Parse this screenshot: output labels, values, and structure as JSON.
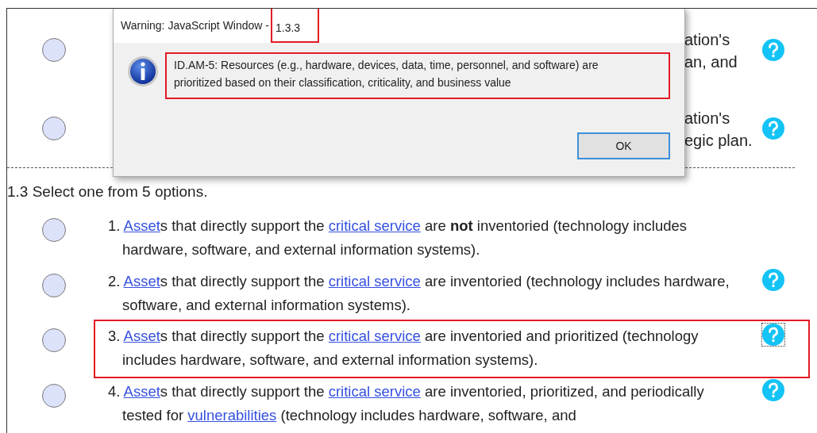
{
  "background_rows": [
    {
      "selected": false,
      "visible_lines": [
        "ation's",
        "an, and"
      ],
      "help": true
    },
    {
      "selected": false,
      "visible_lines": [
        "ation's",
        "egic plan."
      ],
      "help": true
    }
  ],
  "question": {
    "heading": "1.3 Select one from 5 options.",
    "options": [
      {
        "number": "1.",
        "selected": false,
        "help": false,
        "focused": false,
        "highlighted": false,
        "segments": [
          {
            "kind": "link",
            "text": "Asset"
          },
          {
            "kind": "text",
            "text": "s that directly support the "
          },
          {
            "kind": "link",
            "text": "critical service"
          },
          {
            "kind": "text",
            "text": " are "
          },
          {
            "kind": "bold",
            "text": "not"
          },
          {
            "kind": "text",
            "text": " inventoried (technology includes hardware, software, and external information systems)."
          }
        ]
      },
      {
        "number": "2.",
        "selected": false,
        "help": true,
        "focused": false,
        "highlighted": false,
        "segments": [
          {
            "kind": "link",
            "text": "Asset"
          },
          {
            "kind": "text",
            "text": "s that directly support the "
          },
          {
            "kind": "link",
            "text": "critical service"
          },
          {
            "kind": "text",
            "text": " are inventoried (technology includes hardware, software, and external information systems)."
          }
        ]
      },
      {
        "number": "3.",
        "selected": false,
        "help": true,
        "focused": true,
        "highlighted": true,
        "segments": [
          {
            "kind": "link",
            "text": "Asset"
          },
          {
            "kind": "text",
            "text": "s that directly support the "
          },
          {
            "kind": "link",
            "text": "critical service"
          },
          {
            "kind": "text",
            "text": " are inventoried and prioritized (technology includes hardware, software, and external information systems)."
          }
        ]
      },
      {
        "number": "4.",
        "selected": false,
        "help": true,
        "focused": false,
        "highlighted": false,
        "segments": [
          {
            "kind": "link",
            "text": "Asset"
          },
          {
            "kind": "text",
            "text": "s that directly support the "
          },
          {
            "kind": "link",
            "text": "critical service"
          },
          {
            "kind": "text",
            "text": " are inventoried, prioritized, and periodically tested for "
          },
          {
            "kind": "link",
            "text": "vulnerabilities"
          },
          {
            "kind": "text",
            "text": " (technology includes hardware, software, and"
          }
        ]
      }
    ]
  },
  "dialog": {
    "title": "Warning: JavaScript Window -",
    "version": "1.3.3",
    "version_highlighted": true,
    "message": "ID.AM-5: Resources (e.g., hardware, devices, data, time, personnel, and software) are prioritized based on their classification, criticality, and business value",
    "message_highlighted": true,
    "button": "OK"
  }
}
